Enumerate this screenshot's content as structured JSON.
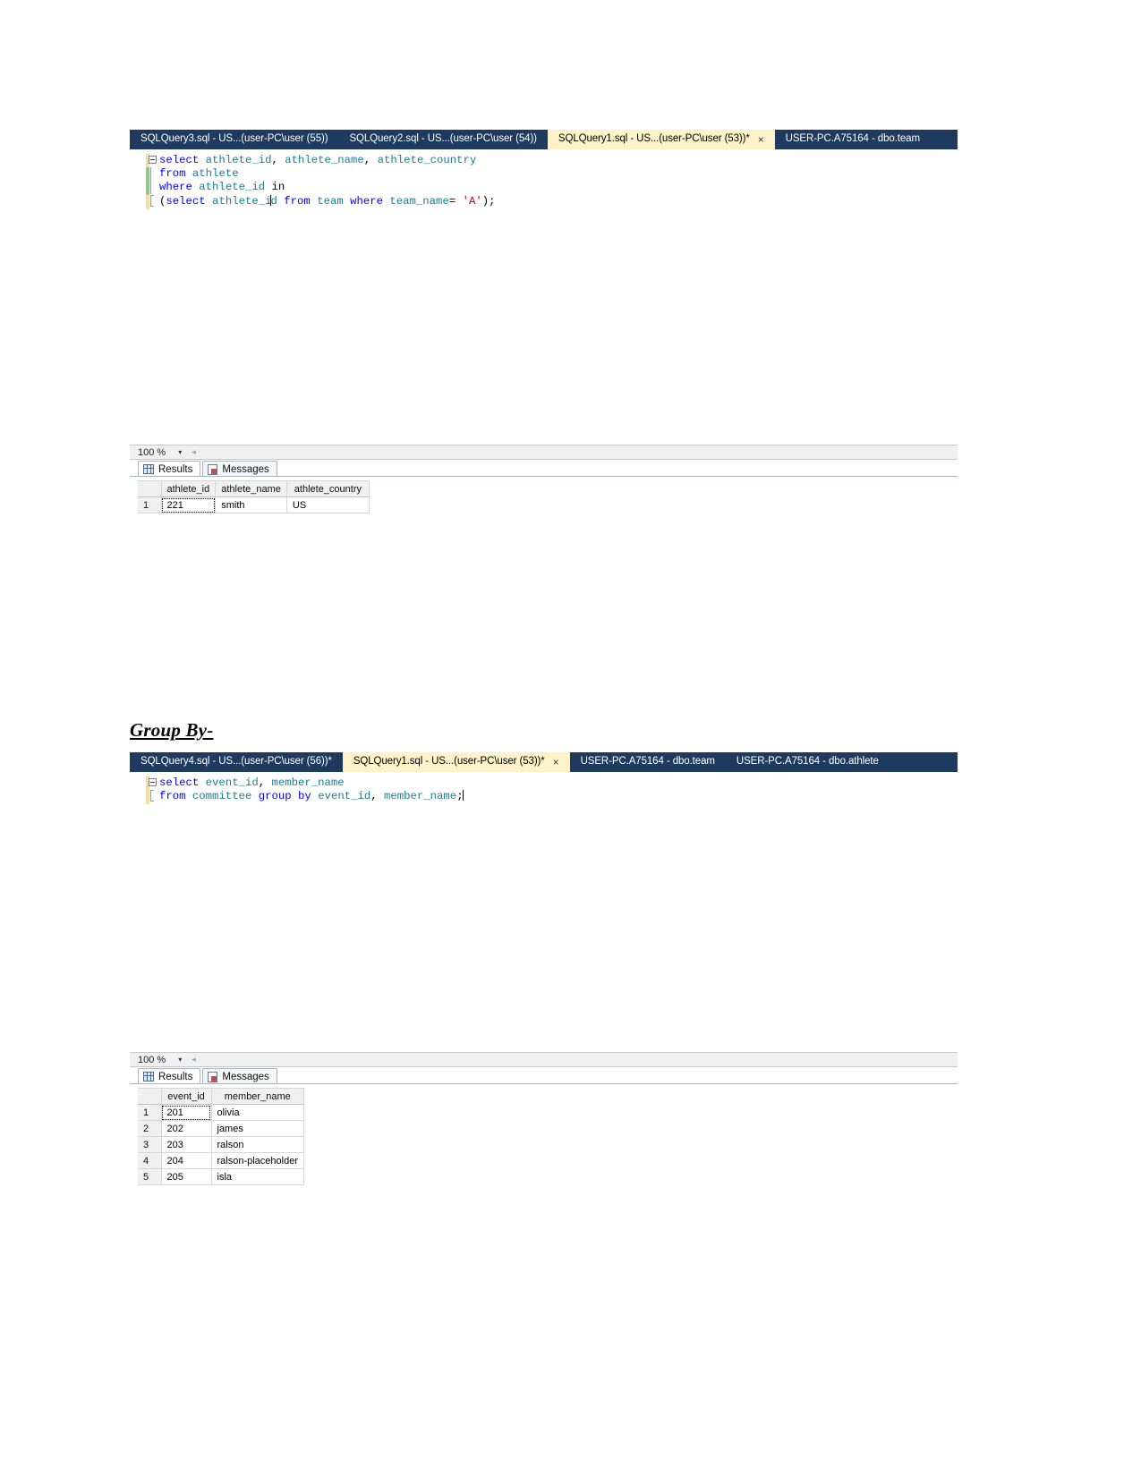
{
  "document": {
    "section_heading": "Group By-"
  },
  "window1": {
    "tabs": [
      {
        "label": "SQLQuery3.sql - US...(user-PC\\user (55))",
        "active": false,
        "closable": false
      },
      {
        "label": "SQLQuery2.sql - US...(user-PC\\user (54))",
        "active": false,
        "closable": false
      },
      {
        "label": "SQLQuery1.sql - US...(user-PC\\user (53))*",
        "active": true,
        "closable": true,
        "close_label": "×"
      },
      {
        "label": "USER-PC.A75164 - dbo.team",
        "active": false,
        "closable": false
      }
    ],
    "editor": {
      "lines": [
        {
          "tokens": [
            {
              "t": "select",
              "c": "kw"
            },
            {
              "t": " ",
              "c": "plain"
            },
            {
              "t": "athlete_id",
              "c": "id"
            },
            {
              "t": ", ",
              "c": "punct"
            },
            {
              "t": "athlete_name",
              "c": "id"
            },
            {
              "t": ", ",
              "c": "punct"
            },
            {
              "t": "athlete_country",
              "c": "id"
            }
          ]
        },
        {
          "tokens": [
            {
              "t": "from",
              "c": "kw"
            },
            {
              "t": " ",
              "c": "plain"
            },
            {
              "t": "athlete",
              "c": "id"
            }
          ]
        },
        {
          "tokens": [
            {
              "t": "where",
              "c": "kw"
            },
            {
              "t": " ",
              "c": "plain"
            },
            {
              "t": "athlete_id",
              "c": "id"
            },
            {
              "t": " ",
              "c": "plain"
            },
            {
              "t": "in",
              "c": "plain"
            }
          ]
        },
        {
          "tokens": [
            {
              "t": "(",
              "c": "punct"
            },
            {
              "t": "select",
              "c": "kw"
            },
            {
              "t": " ",
              "c": "plain"
            },
            {
              "t": "athlete_i",
              "c": "id"
            },
            {
              "t": "CARET",
              "c": "caret"
            },
            {
              "t": "d",
              "c": "id"
            },
            {
              "t": " ",
              "c": "plain"
            },
            {
              "t": "from",
              "c": "kw"
            },
            {
              "t": " ",
              "c": "plain"
            },
            {
              "t": "team",
              "c": "id"
            },
            {
              "t": " ",
              "c": "plain"
            },
            {
              "t": "where",
              "c": "kw"
            },
            {
              "t": " ",
              "c": "plain"
            },
            {
              "t": "team_name",
              "c": "id"
            },
            {
              "t": "= ",
              "c": "punct"
            },
            {
              "t": "'A'",
              "c": "str"
            },
            {
              "t": ");",
              "c": "punct"
            }
          ]
        }
      ]
    },
    "zoombar": {
      "percent": "100 %",
      "dropdown_glyph": "▾",
      "splitter_glyph": "◂"
    },
    "results": {
      "tabs": [
        {
          "label": "Results",
          "icon": "grid-icon",
          "active": true
        },
        {
          "label": "Messages",
          "icon": "message-icon",
          "active": false
        }
      ],
      "columns": [
        "athlete_id",
        "athlete_name",
        "athlete_country"
      ],
      "rows": [
        {
          "n": "1",
          "cells": [
            "221",
            "smith",
            "US"
          ]
        }
      ]
    }
  },
  "window2": {
    "tabs": [
      {
        "label": "SQLQuery4.sql - US...(user-PC\\user (56))*",
        "active": false,
        "closable": false
      },
      {
        "label": "SQLQuery1.sql - US...(user-PC\\user (53))*",
        "active": true,
        "closable": true,
        "close_label": "×"
      },
      {
        "label": "USER-PC.A75164 - dbo.team",
        "active": false,
        "closable": false
      },
      {
        "label": "USER-PC.A75164 - dbo.athlete",
        "active": false,
        "closable": false
      }
    ],
    "editor": {
      "lines": [
        {
          "tokens": [
            {
              "t": "select",
              "c": "kw"
            },
            {
              "t": " ",
              "c": "plain"
            },
            {
              "t": "event_id",
              "c": "id"
            },
            {
              "t": ", ",
              "c": "punct"
            },
            {
              "t": "member_name",
              "c": "id"
            }
          ]
        },
        {
          "tokens": [
            {
              "t": "from",
              "c": "kw"
            },
            {
              "t": " ",
              "c": "plain"
            },
            {
              "t": "committee",
              "c": "id"
            },
            {
              "t": " ",
              "c": "plain"
            },
            {
              "t": "group",
              "c": "kw"
            },
            {
              "t": " ",
              "c": "plain"
            },
            {
              "t": "by",
              "c": "kw"
            },
            {
              "t": " ",
              "c": "plain"
            },
            {
              "t": "event_id",
              "c": "id"
            },
            {
              "t": ", ",
              "c": "punct"
            },
            {
              "t": "member_name",
              "c": "id"
            },
            {
              "t": ";",
              "c": "punct"
            },
            {
              "t": "CARET",
              "c": "caret"
            }
          ]
        }
      ]
    },
    "zoombar": {
      "percent": "100 %",
      "dropdown_glyph": "▾",
      "splitter_glyph": "◂"
    },
    "results": {
      "tabs": [
        {
          "label": "Results",
          "icon": "grid-icon",
          "active": true
        },
        {
          "label": "Messages",
          "icon": "message-icon",
          "active": false
        }
      ],
      "columns": [
        "event_id",
        "member_name"
      ],
      "rows": [
        {
          "n": "1",
          "cells": [
            "201",
            "olivia"
          ]
        },
        {
          "n": "2",
          "cells": [
            "202",
            "james"
          ]
        },
        {
          "n": "3",
          "cells": [
            "203",
            "ralson"
          ]
        },
        {
          "n": "4",
          "cells": [
            "204",
            "ralson-placeholder"
          ]
        },
        {
          "n": "5",
          "cells": [
            "205",
            "isla"
          ]
        }
      ]
    }
  },
  "colors": {
    "tabstrip_bg": "#1e3a5f",
    "active_tab_bg": "#fdf2c8",
    "keyword": "#0000ff",
    "identifier": "#1b7f8f",
    "string": "#cc0000"
  }
}
